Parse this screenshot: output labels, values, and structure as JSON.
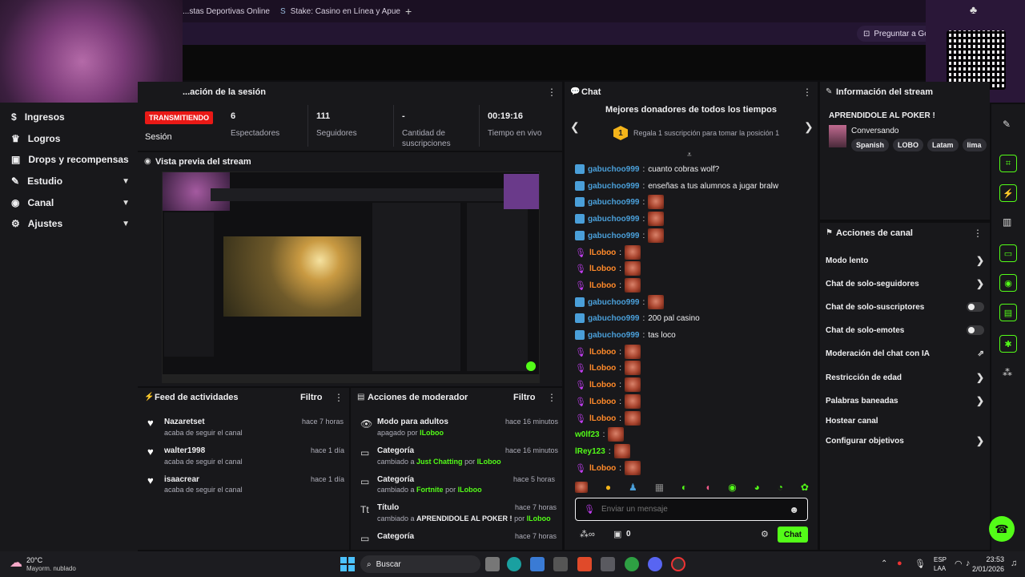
{
  "browser": {
    "tabs": [
      {
        "label": "...stas Deportivas Online | Ap"
      },
      {
        "label": "Stake: Casino en Línea y Apues"
      }
    ],
    "ask_google": "Preguntar a Goog"
  },
  "nav": {
    "items": [
      {
        "label": "Ingresos",
        "icon": "dollar-icon"
      },
      {
        "label": "Logros",
        "icon": "trophy-icon"
      },
      {
        "label": "Drops y recompensas",
        "icon": "gift-icon"
      },
      {
        "label": "Estudio",
        "icon": "pencil-icon",
        "chevron": true
      },
      {
        "label": "Canal",
        "icon": "broadcast-icon",
        "chevron": true
      },
      {
        "label": "Ajustes",
        "icon": "gear-icon",
        "chevron": true
      }
    ]
  },
  "session": {
    "title": "...ación de la sesión",
    "live_badge": "TRANSMITIENDO",
    "session_label": "Sesión",
    "viewers_value": "6",
    "viewers_label": "Espectadores",
    "followers_value": "111",
    "followers_label": "Seguidores",
    "subs_value": "-",
    "subs_label": "Cantidad de suscripciones",
    "uptime_value": "00:19:16",
    "uptime_label": "Tiempo en vivo"
  },
  "preview": {
    "title": "Vista previa del stream"
  },
  "activity": {
    "title": "Feed de actividades",
    "filter": "Filtro",
    "items": [
      {
        "user": "Nazaretset",
        "text": "acaba de seguir el canal",
        "time": "hace 7 horas"
      },
      {
        "user": "walter1998",
        "text": "acaba de seguir el canal",
        "time": "hace 1 día"
      },
      {
        "user": "isaacrear",
        "text": "acaba de seguir el canal",
        "time": "hace 1 día"
      }
    ]
  },
  "modactions": {
    "title": "Acciones de moderador",
    "filter": "Filtro",
    "items": [
      {
        "title": "Modo para adultos",
        "pre": "apagado por",
        "value": "",
        "mid": "",
        "by": "lLoboo",
        "time": "hace 16 minutos"
      },
      {
        "title": "Categoría",
        "pre": "cambiado a",
        "value": "Just Chatting",
        "mid": "por",
        "by": "lLoboo",
        "time": "hace 16 minutos"
      },
      {
        "title": "Categoría",
        "pre": "cambiado a",
        "value": "Fortnite",
        "mid": "por",
        "by": "lLoboo",
        "time": "hace 5 horas"
      },
      {
        "title": "Título",
        "pre": "cambiado a",
        "value": "APRENDIDOLE AL POKER !",
        "mid": "por",
        "by": "lLoboo",
        "time": "hace 7 horas"
      },
      {
        "title": "Categoría",
        "pre": "",
        "value": "",
        "mid": "",
        "by": "",
        "time": "hace 7 horas"
      }
    ]
  },
  "chat": {
    "title": "Chat",
    "donors_title": "Mejores donadores de todos los tiempos",
    "donor_rank": "1",
    "donor_text": "Regala 1 suscripción para tomar la posición 1",
    "messages": [
      {
        "user": "gabuchoo999",
        "text": "cuanto cobras wolf?",
        "kind": "blue",
        "emote": false
      },
      {
        "user": "gabuchoo999",
        "text": "enseñas a tus alumnos a jugar bralw",
        "kind": "blue",
        "emote": false
      },
      {
        "user": "gabuchoo999",
        "text": "",
        "kind": "blue",
        "emote": true
      },
      {
        "user": "gabuchoo999",
        "text": "",
        "kind": "blue",
        "emote": true
      },
      {
        "user": "gabuchoo999",
        "text": "",
        "kind": "blue",
        "emote": true
      },
      {
        "user": "lLoboo",
        "text": "",
        "kind": "orange",
        "emote": true
      },
      {
        "user": "lLoboo",
        "text": "",
        "kind": "orange",
        "emote": true
      },
      {
        "user": "lLoboo",
        "text": "",
        "kind": "orange",
        "emote": true
      },
      {
        "user": "gabuchoo999",
        "text": "",
        "kind": "blue",
        "emote": true
      },
      {
        "user": "gabuchoo999",
        "text": "200 pal casino",
        "kind": "blue",
        "emote": false
      },
      {
        "user": "gabuchoo999",
        "text": "tas loco",
        "kind": "blue",
        "emote": false
      },
      {
        "user": "lLoboo",
        "text": "",
        "kind": "orange",
        "emote": true
      },
      {
        "user": "lLoboo",
        "text": "",
        "kind": "orange",
        "emote": true
      },
      {
        "user": "lLoboo",
        "text": "",
        "kind": "orange",
        "emote": true
      },
      {
        "user": "lLoboo",
        "text": "",
        "kind": "orange",
        "emote": true
      },
      {
        "user": "lLoboo",
        "text": "",
        "kind": "orange",
        "emote": true
      },
      {
        "user": "w0lf23",
        "text": "",
        "kind": "green",
        "emote": true
      },
      {
        "user": "lRey123",
        "text": "",
        "kind": "green",
        "emote": true
      },
      {
        "user": "lLoboo",
        "text": "",
        "kind": "orange",
        "emote": true
      }
    ],
    "input_placeholder": "Enviar un mensaje",
    "points": "0",
    "send": "Chat"
  },
  "streaminfo": {
    "title": "Información del stream",
    "stream_title": "APRENDIDOLE AL POKER !",
    "category": "Conversando",
    "tags": [
      "Spanish",
      "LOBO",
      "Latam",
      "lima"
    ]
  },
  "channel_actions": {
    "title": "Acciones de canal",
    "items": [
      {
        "label": "Modo lento",
        "control": "arrow"
      },
      {
        "label": "Chat de solo-seguidores",
        "control": "arrow"
      },
      {
        "label": "Chat de solo-suscriptores",
        "control": "toggle"
      },
      {
        "label": "Chat de solo-emotes",
        "control": "toggle"
      },
      {
        "label": "Moderación del chat con IA",
        "control": "external"
      },
      {
        "label": "Restricción de edad",
        "control": "arrow"
      },
      {
        "label": "Palabras baneadas",
        "control": "arrow"
      },
      {
        "label": "Hostear canal",
        "control": "none"
      },
      {
        "label": "Configurar objetivos",
        "control": "arrow"
      }
    ]
  },
  "taskbar": {
    "temp": "20°C",
    "weather": "Mayorm. nublado",
    "search": "Buscar",
    "lang1": "ESP",
    "lang2": "LAA",
    "time": "23:53",
    "date": "2/01/2026"
  },
  "colors": {
    "accent": "#53fc18",
    "live": "#e91916",
    "panel": "#18181b",
    "bg": "#0e0e10"
  }
}
